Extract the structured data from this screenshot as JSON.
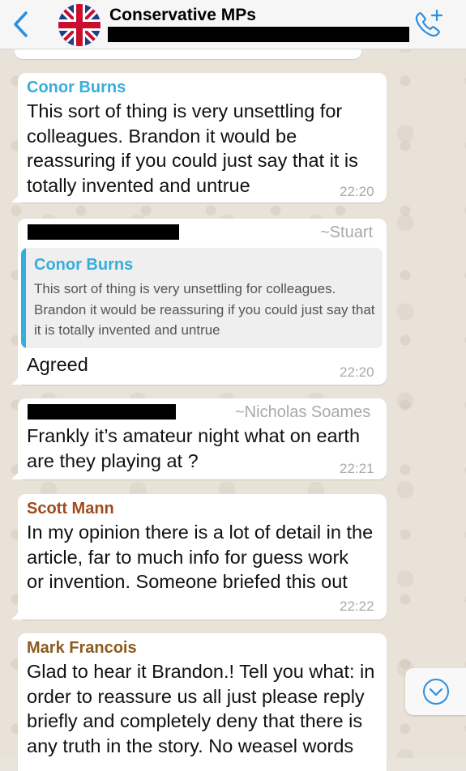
{
  "header": {
    "back_label": "Back",
    "title": "Conservative MPs"
  },
  "colors": {
    "accent": "#2a8fe0",
    "conor": "#35aedb",
    "scott": "#a24a1d",
    "mark": "#8b5a1e"
  },
  "icons": [
    "back-chevron-icon",
    "union-jack-avatar",
    "add-call-icon",
    "chevron-down-icon"
  ],
  "messages": [
    {
      "sender": "Conor Burns",
      "text": "This sort of thing is very unsettling for\ncolleagues. Brandon it would be\nreassuring if you could just say that it is\ntotally invented and untrue",
      "time": "22:20"
    },
    {
      "handle": "~Stuart",
      "quote_sender": "Conor Burns",
      "quote_text": "This sort of thing is very unsettling for colleagues. Brandon it would be reassuring if you could just say that it is totally invented and untrue",
      "text": "Agreed",
      "time": "22:20"
    },
    {
      "handle": "~Nicholas Soames",
      "text": "Frankly it’s amateur night what on earth\nare they playing at ?",
      "time": "22:21"
    },
    {
      "sender": "Scott Mann",
      "text": "In my opinion there is a lot of detail in the\narticle, far to much info for guess work\nor invention. Someone briefed this out",
      "time": "22:22"
    },
    {
      "sender": "Mark Francois",
      "text": "Glad to hear it Brandon.! Tell you what: in\norder to reassure us all just please reply\nbriefly and completely deny that there is\nany truth in the story. No weasel words"
    }
  ]
}
